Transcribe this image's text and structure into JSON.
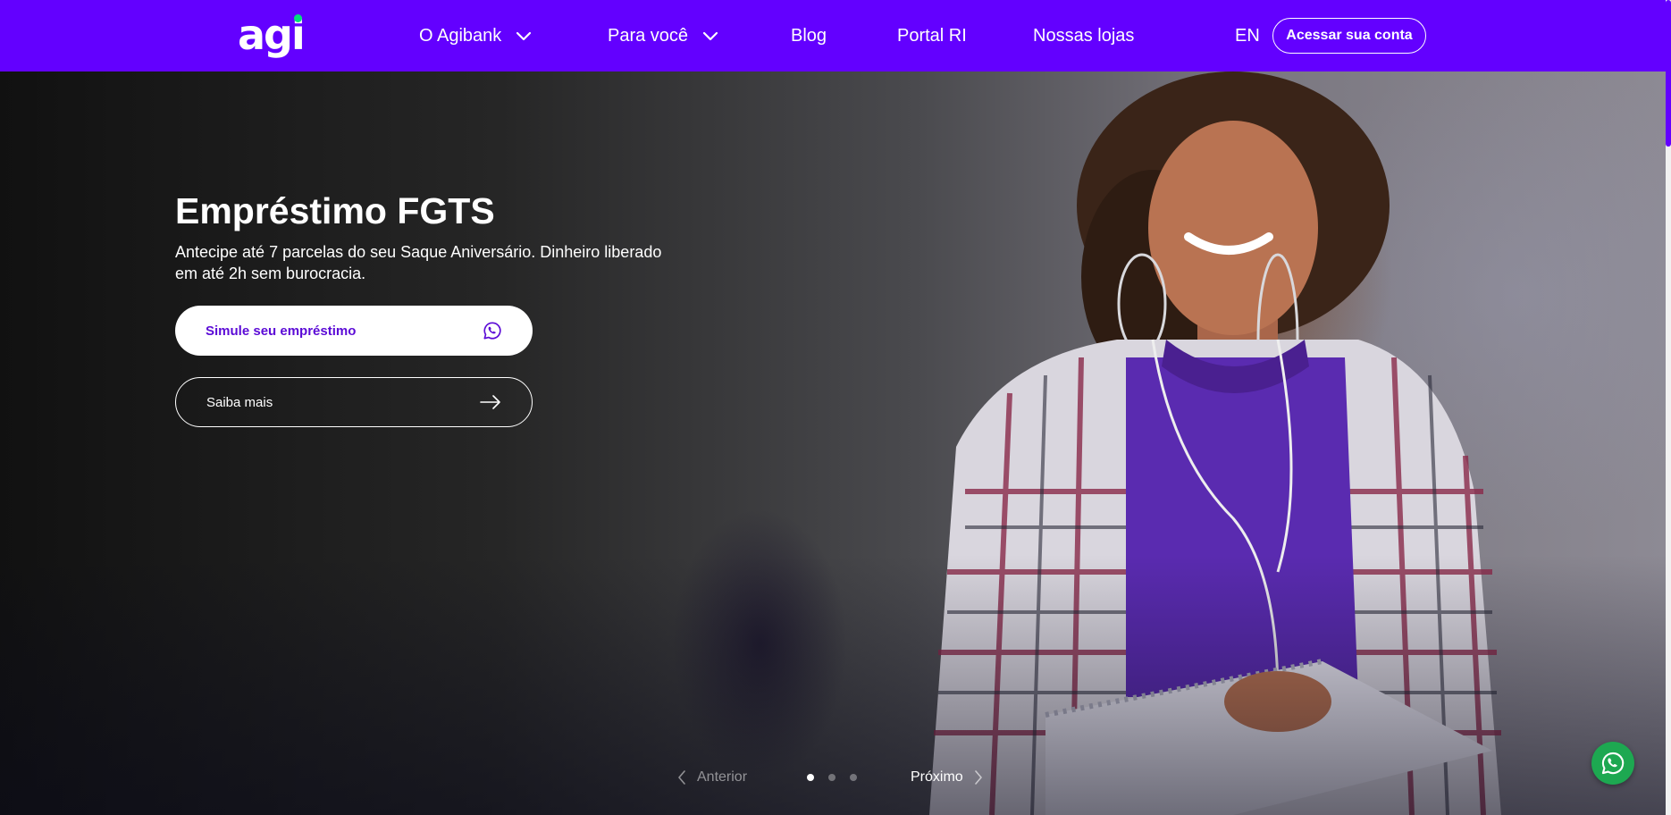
{
  "header": {
    "logo_text": "agi",
    "nav": [
      {
        "label": "O Agibank",
        "has_dropdown": true
      },
      {
        "label": "Para você",
        "has_dropdown": true
      },
      {
        "label": "Blog",
        "has_dropdown": false
      },
      {
        "label": "Portal RI",
        "has_dropdown": false
      },
      {
        "label": "Nossas lojas",
        "has_dropdown": false
      }
    ],
    "language": "EN",
    "account_button": "Acessar sua conta"
  },
  "hero": {
    "title": "Empréstimo FGTS",
    "subtitle": "Antecipe até 7 parcelas do seu Saque Aniversário. Dinheiro liberado em até 2h sem burocracia.",
    "primary_cta": "Simule seu empréstimo",
    "primary_cta_icon": "whatsapp-icon",
    "secondary_cta": "Saiba mais",
    "secondary_cta_icon": "arrow-right-icon"
  },
  "carousel": {
    "prev_label": "Anterior",
    "next_label": "Próximo",
    "slide_count": 3,
    "active_slide": 1
  },
  "floating_whatsapp": {
    "icon": "whatsapp-icon"
  },
  "colors": {
    "brand_purple": "#6300ff",
    "logo_dot_green": "#00e07a",
    "whatsapp_green": "#1da851",
    "cta_text_purple": "#5b0ad6"
  }
}
